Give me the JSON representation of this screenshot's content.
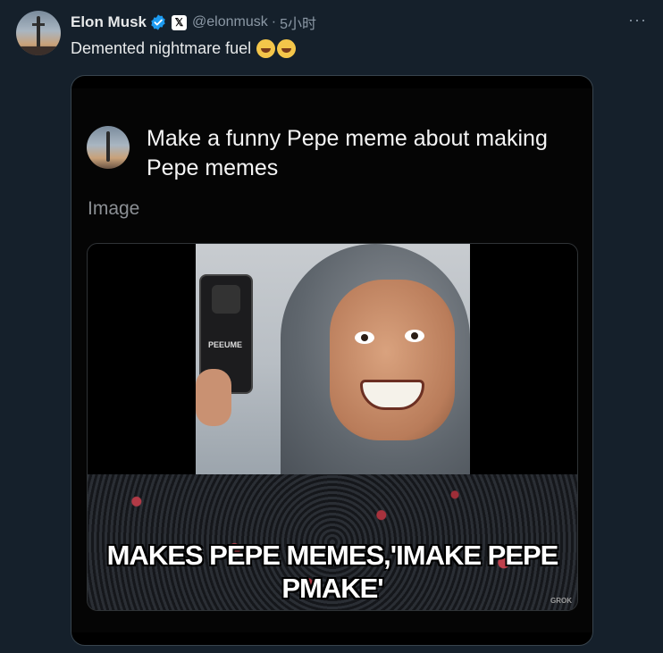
{
  "tweet": {
    "author_name": "Elon Musk",
    "handle": "@elonmusk",
    "separator": "·",
    "time": "5小时",
    "more_label": "···",
    "text": "Demented nightmare fuel",
    "emojis": [
      "rolling-on-floor-laughing",
      "rolling-on-floor-laughing"
    ]
  },
  "badges": {
    "verified_color": "#1d9bf0",
    "x_badge_letter": "𝕏"
  },
  "card": {
    "prompt": "Make a funny Pepe meme about making Pepe memes",
    "image_label": "Image",
    "meme_caption_line1": "MAKES PEPE MEMES,'IMAKE PEPE",
    "meme_caption_line2": "PMAKE'",
    "phone_brand": "PEEUME",
    "watermark": "GROK"
  },
  "colors": {
    "background": "#15202b",
    "text_primary": "#e7e9ea",
    "text_secondary": "#8b98a5",
    "card_border": "#38444d"
  }
}
